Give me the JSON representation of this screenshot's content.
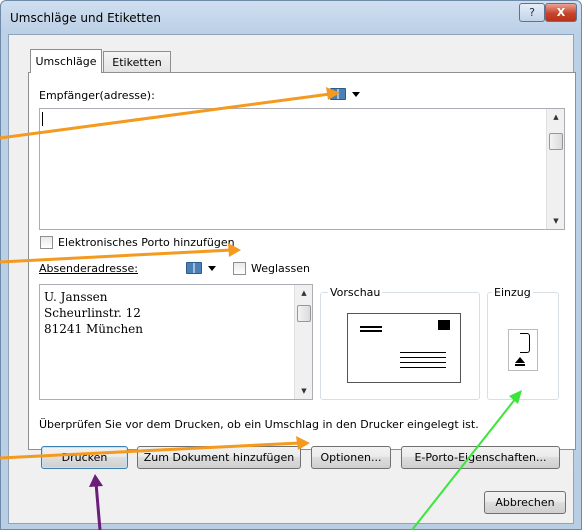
{
  "window": {
    "title": "Umschläge und Etiketten",
    "help_glyph": "?",
    "close_glyph": "X"
  },
  "tabs": [
    {
      "label": "Umschläge",
      "active": true
    },
    {
      "label": "Etiketten",
      "active": false
    }
  ],
  "recipient": {
    "label": "Empfänger(adresse):",
    "value": ""
  },
  "electronic_postage": {
    "label": "Elektronisches Porto hinzufügen",
    "checked": false
  },
  "sender": {
    "label": "Absenderadresse:",
    "omit_label": "Weglassen",
    "omit_checked": false,
    "address_lines": [
      "U. Janssen",
      "Scheurlinstr. 12",
      "81241 München"
    ]
  },
  "preview": {
    "label": "Vorschau"
  },
  "feed": {
    "label": "Einzug"
  },
  "info_text": "Überprüfen Sie vor dem Drucken, ob ein Umschlag in den Drucker eingelegt ist.",
  "buttons": {
    "print": "Drucken",
    "add_to_document": "Zum Dokument hinzufügen",
    "options": "Optionen...",
    "epostage_properties": "E-Porto-Eigenschaften...",
    "cancel": "Abbrechen"
  },
  "annotation_colors": {
    "orange": "#f39a1f",
    "purple": "#6b1d7a",
    "green": "#39e639"
  }
}
